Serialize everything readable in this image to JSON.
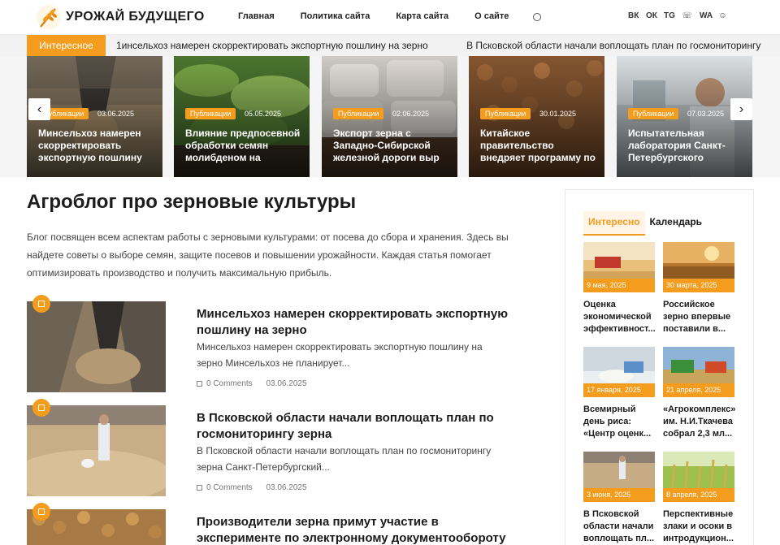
{
  "header": {
    "site_name": "УРОЖАЙ БУДУЩЕГО",
    "nav": [
      "Главная",
      "Политика сайта",
      "Карта сайта",
      "О сайте"
    ],
    "social": [
      "vk",
      "ok",
      "tg",
      "viber",
      "wa",
      "ya"
    ],
    "social_labels": [
      "ВК",
      "ОК",
      "TG",
      "☏",
      "WA",
      "☺"
    ]
  },
  "ticker": {
    "label": "Интересное",
    "items": [
      "1инсельхоз намерен скорректировать экспортную пошлину на зерно",
      "В Псковской области начали воплощать план по госмониторингу"
    ]
  },
  "slider": {
    "prev": "‹",
    "next": "›",
    "slides": [
      {
        "tag": "Публикации",
        "date": "03.06.2025",
        "title": "Минсельхоз намерен скорректировать экспортную пошлину"
      },
      {
        "tag": "Публикации",
        "date": "05.05.2025",
        "title": "Влияние предпосевной обработки семян молибденом на"
      },
      {
        "tag": "Публикации",
        "date": "02.06.2025",
        "title": "Экспорт зерна с Западно-Сибирской железной дороги выр"
      },
      {
        "tag": "Публикации",
        "date": "30.01.2025",
        "title": "Китайское правительство внедряет программу по"
      },
      {
        "tag": "Публикации",
        "date": "07.03.2025",
        "title": "Испытательная лаборатория Санкт-Петербургского"
      }
    ]
  },
  "main": {
    "title": "Агроблог про зерновые культуры",
    "intro": "Блог посвящен всем аспектам работы с зерновыми культурами: от посева до сбора и хранения. Здесь вы найдете советы о выборе семян, защите посевов и повышении урожайности. Каждая статья помогает оптимизировать производство и получить максимальную прибыль.",
    "posts": [
      {
        "title": "Минсельхоз намерен скорректировать экспортную пошлину на зерно",
        "excerpt": "Минсельхоз намерен скорректировать экспортную пошлину на зерно Минсельхоз не планирует...",
        "comments": "0 Comments",
        "date": "03.06.2025"
      },
      {
        "title": "В Псковской области начали воплощать план по госмониторингу зерна",
        "excerpt": "В Псковской области начали воплощать план по госмониторингу зерна Санкт-Петербургский...",
        "comments": "0 Comments",
        "date": "03.06.2025"
      },
      {
        "title": "Производители зерна примут участие в эксперименте по электронному документообороту",
        "excerpt": "",
        "comments": "",
        "date": ""
      }
    ]
  },
  "sidebar": {
    "tabs": [
      "Интересно",
      "Календарь"
    ],
    "cards": [
      {
        "date": "9 мая, 2025",
        "title": "Оценка экономической эффективност..."
      },
      {
        "date": "30 марта, 2025",
        "title": "Российское зерно впервые поставили в..."
      },
      {
        "date": "17 января, 2025",
        "title": "Всемирный день риса: «Центр оценк..."
      },
      {
        "date": "21 апреля, 2025",
        "title": "«Агрокомплекс» им. Н.И.Ткачева собрал 2,3 мл..."
      },
      {
        "date": "3 июня, 2025",
        "title": "В Псковской области начали воплощать пл..."
      },
      {
        "date": "8 апреля, 2025",
        "title": "Перспективные злаки и осоки в интродукцион..."
      }
    ]
  },
  "colors": {
    "accent": "#f39c1d",
    "text": "#1b1b1b"
  }
}
